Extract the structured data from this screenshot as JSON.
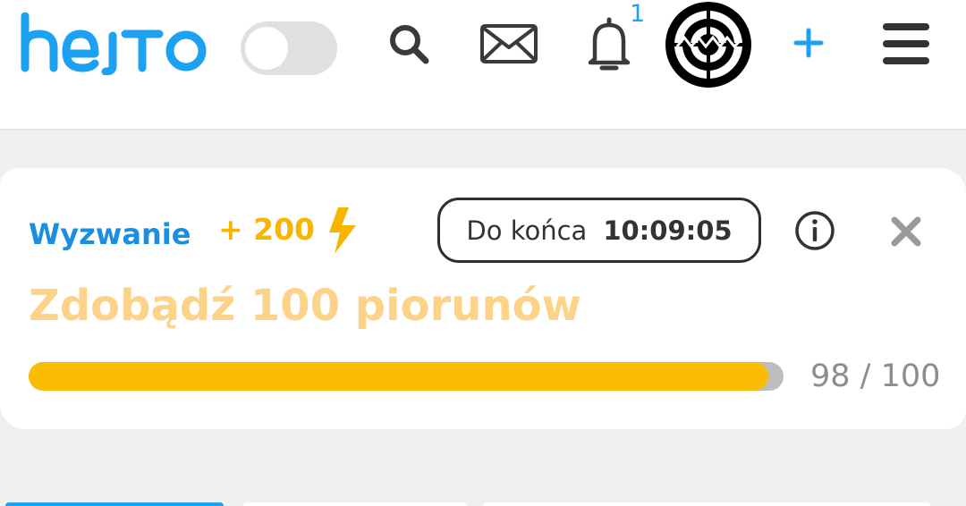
{
  "header": {
    "logo_text": "hejto",
    "notification_count": "1",
    "theme_toggle_on": false,
    "icons": [
      "search-icon",
      "mail-icon",
      "bell-icon",
      "plus-icon",
      "menu-icon"
    ],
    "accent_color": "#1da1f2"
  },
  "challenge": {
    "label": "Wyzwanie",
    "reward": "+ 200",
    "reward_icon": "lightning-bolt-icon",
    "timer_label": "Do końca",
    "timer_value": "10:09:05",
    "title": "Zdobądź 100 piorunów",
    "progress_current": 98,
    "progress_total": 100,
    "progress_text": "98 / 100",
    "colors": {
      "label": "#1a8fe0",
      "reward": "#f7b500",
      "title": "#fdd289",
      "bar_fill": "#fbbc04",
      "bar_track": "#bdbdbd"
    }
  }
}
